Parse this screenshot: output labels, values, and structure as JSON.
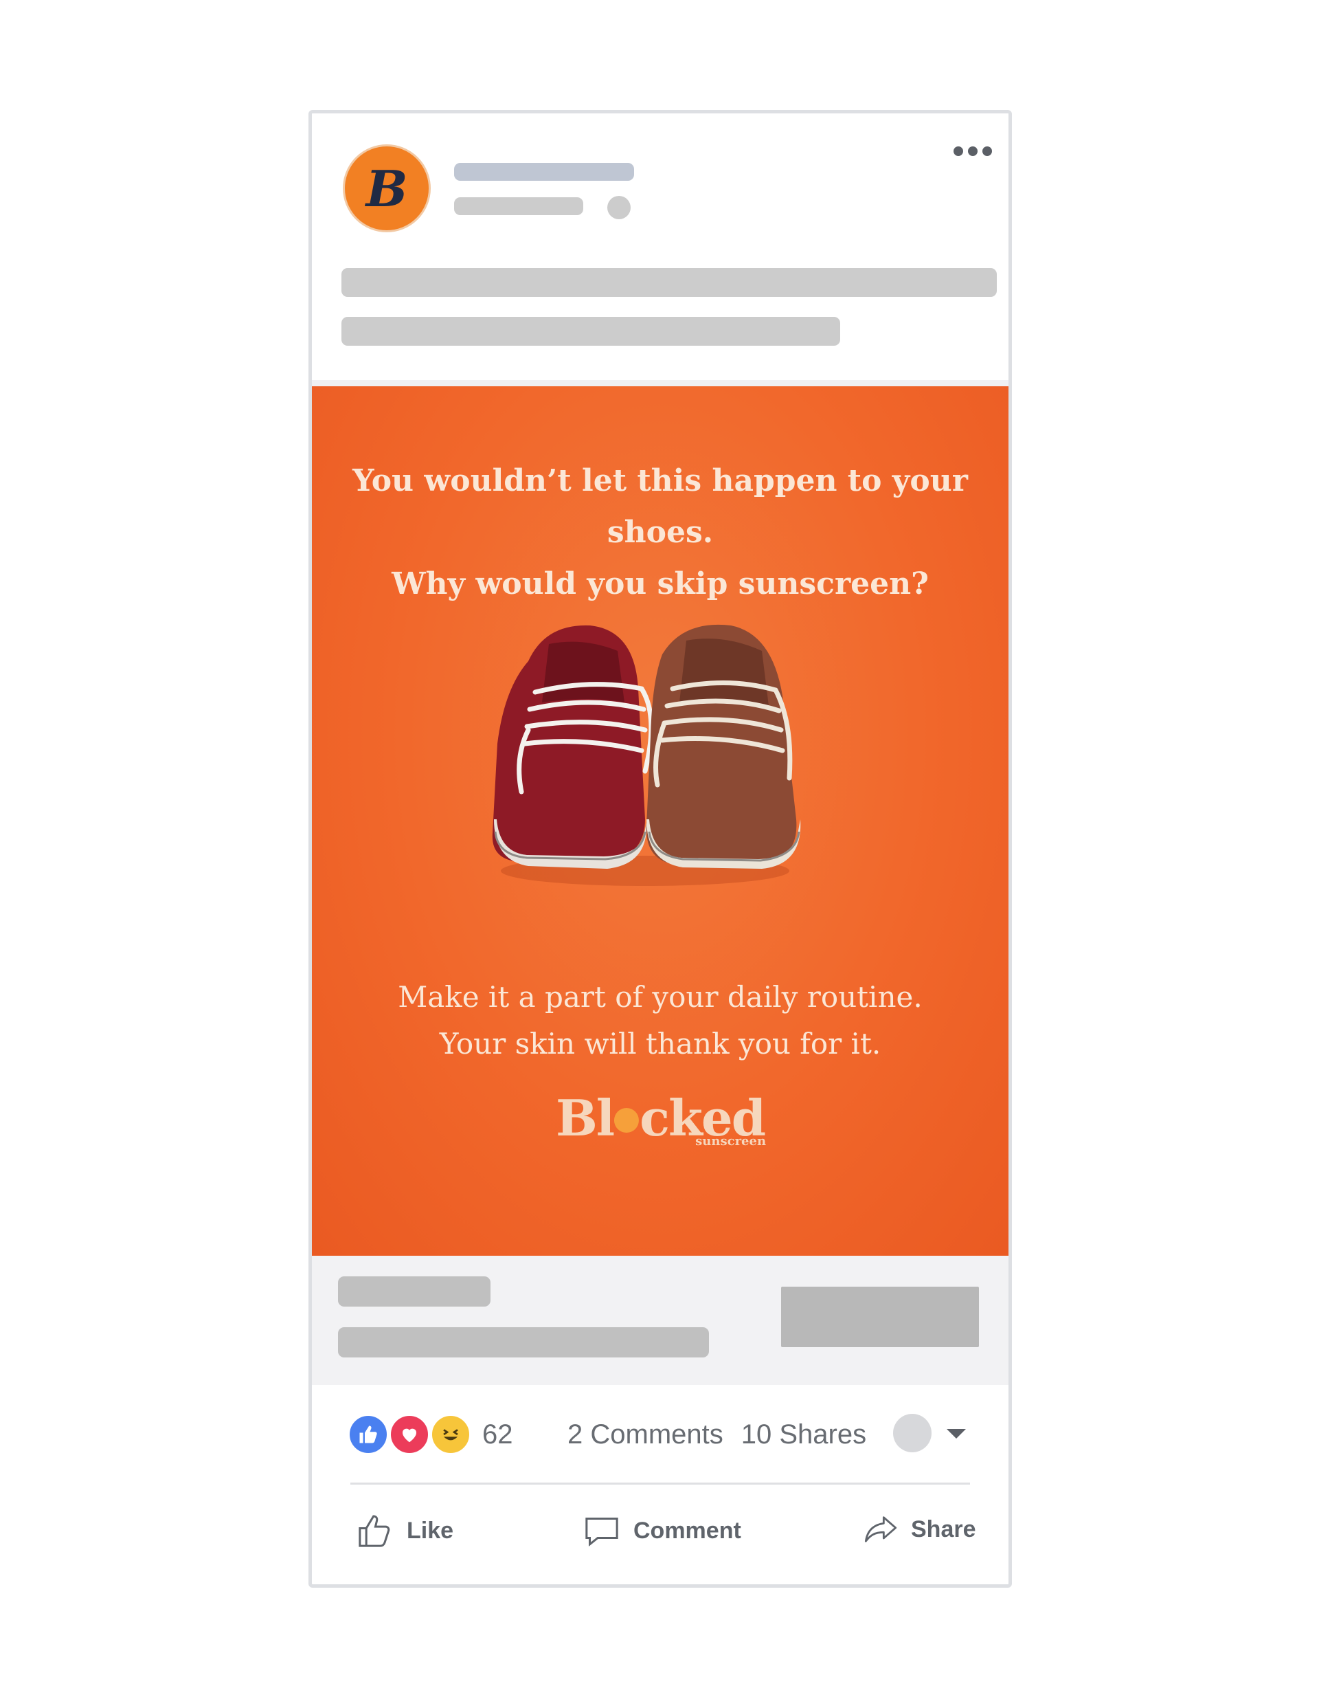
{
  "post": {
    "avatar_letter": "B",
    "brand_color": "#f28023",
    "more_icon": "ellipsis-icon"
  },
  "ad": {
    "headline_line1": "You wouldn’t let this happen to your shoes.",
    "headline_line2": "Why would you skip sunscreen?",
    "body_line1": "Make it a part of your daily routine.",
    "body_line2": "Your skin will thank you for it.",
    "logo_left": "Bl",
    "logo_right": "cked",
    "logo_sub": "sunscreen",
    "background_color": "#f1672b"
  },
  "reactions": {
    "count": "62",
    "comments": "2 Comments",
    "shares": "10 Shares",
    "icons": [
      "like-icon",
      "love-icon",
      "haha-icon"
    ]
  },
  "actions": {
    "like": "Like",
    "comment": "Comment",
    "share": "Share"
  }
}
